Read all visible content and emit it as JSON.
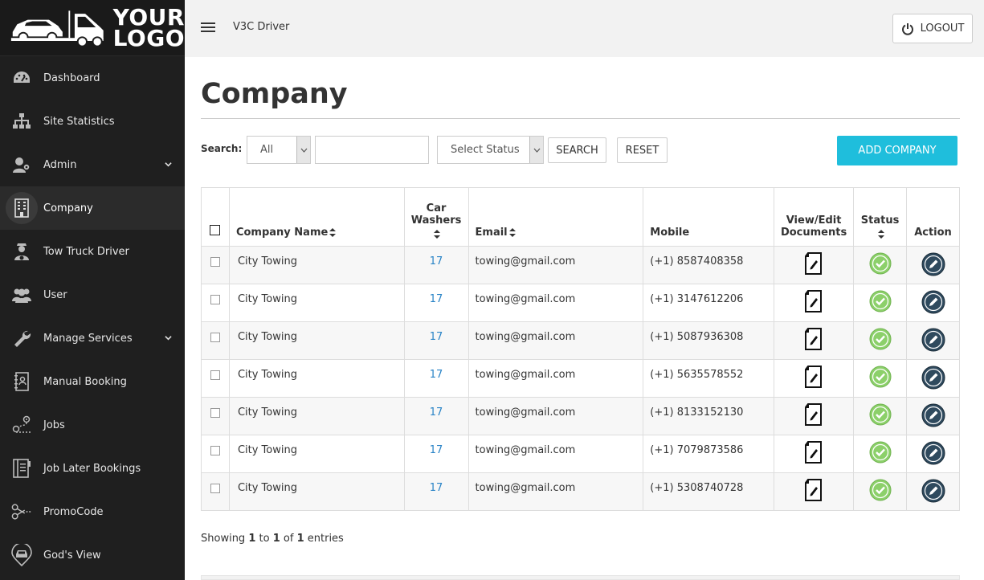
{
  "logo": {
    "line1": "YOUR",
    "line2": "LOGO"
  },
  "sidebar": {
    "items": [
      {
        "label": "Dashboard",
        "icon": "dashboard-icon"
      },
      {
        "label": "Site Statistics",
        "icon": "sitemap-icon"
      },
      {
        "label": "Admin",
        "icon": "admin-users-icon",
        "expandable": true
      },
      {
        "label": "Company",
        "icon": "building-icon",
        "active": true
      },
      {
        "label": "Tow Truck Driver",
        "icon": "driver-icon"
      },
      {
        "label": "User",
        "icon": "users-icon"
      },
      {
        "label": "Manage Services",
        "icon": "wrench-icon",
        "expandable": true
      },
      {
        "label": "Manual Booking",
        "icon": "notebook-icon"
      },
      {
        "label": "Jobs",
        "icon": "route-icon"
      },
      {
        "label": "Job Later Bookings",
        "icon": "calendar-book-icon"
      },
      {
        "label": "PromoCode",
        "icon": "scissors-icon"
      },
      {
        "label": "God's View",
        "icon": "map-pin-car-icon"
      }
    ]
  },
  "topbar": {
    "brand": "V3C Driver",
    "logout": "LOGOUT"
  },
  "page": {
    "title": "Company"
  },
  "search": {
    "label": "Search:",
    "field_select": "All",
    "status_select": "Select Status",
    "search_btn": "SEARCH",
    "reset_btn": "RESET",
    "add_btn": "ADD COMPANY"
  },
  "table": {
    "headers": {
      "company_name": "Company Name",
      "car_washers_1": "Car",
      "car_washers_2": "Washers",
      "email": "Email",
      "mobile": "Mobile",
      "docs_1": "View/Edit",
      "docs_2": "Documents",
      "status": "Status",
      "action": "Action"
    },
    "rows": [
      {
        "name": "City Towing",
        "washers": "17",
        "email": "towing@gmail.com",
        "mobile": "(+1) 8587408358"
      },
      {
        "name": "City Towing",
        "washers": "17",
        "email": "towing@gmail.com",
        "mobile": "(+1) 3147612206"
      },
      {
        "name": "City Towing",
        "washers": "17",
        "email": "towing@gmail.com",
        "mobile": "(+1) 5087936308"
      },
      {
        "name": "City Towing",
        "washers": "17",
        "email": "towing@gmail.com",
        "mobile": "(+1) 5635578552"
      },
      {
        "name": "City Towing",
        "washers": "17",
        "email": "towing@gmail.com",
        "mobile": "(+1) 8133152130"
      },
      {
        "name": "City Towing",
        "washers": "17",
        "email": "towing@gmail.com",
        "mobile": "(+1) 7079873586"
      },
      {
        "name": "City Towing",
        "washers": "17",
        "email": "towing@gmail.com",
        "mobile": "(+1) 5308740728"
      }
    ]
  },
  "footer": {
    "prefix": "Showing",
    "from": "1",
    "to_word": "to",
    "to": "1",
    "of_word": "of",
    "total": "1",
    "suffix": "entries"
  },
  "colors": {
    "accent": "#1fbedc",
    "status_ok": "#8cd06a",
    "action": "#2f4a5e",
    "sidebar_bg": "#1f1f1f"
  }
}
